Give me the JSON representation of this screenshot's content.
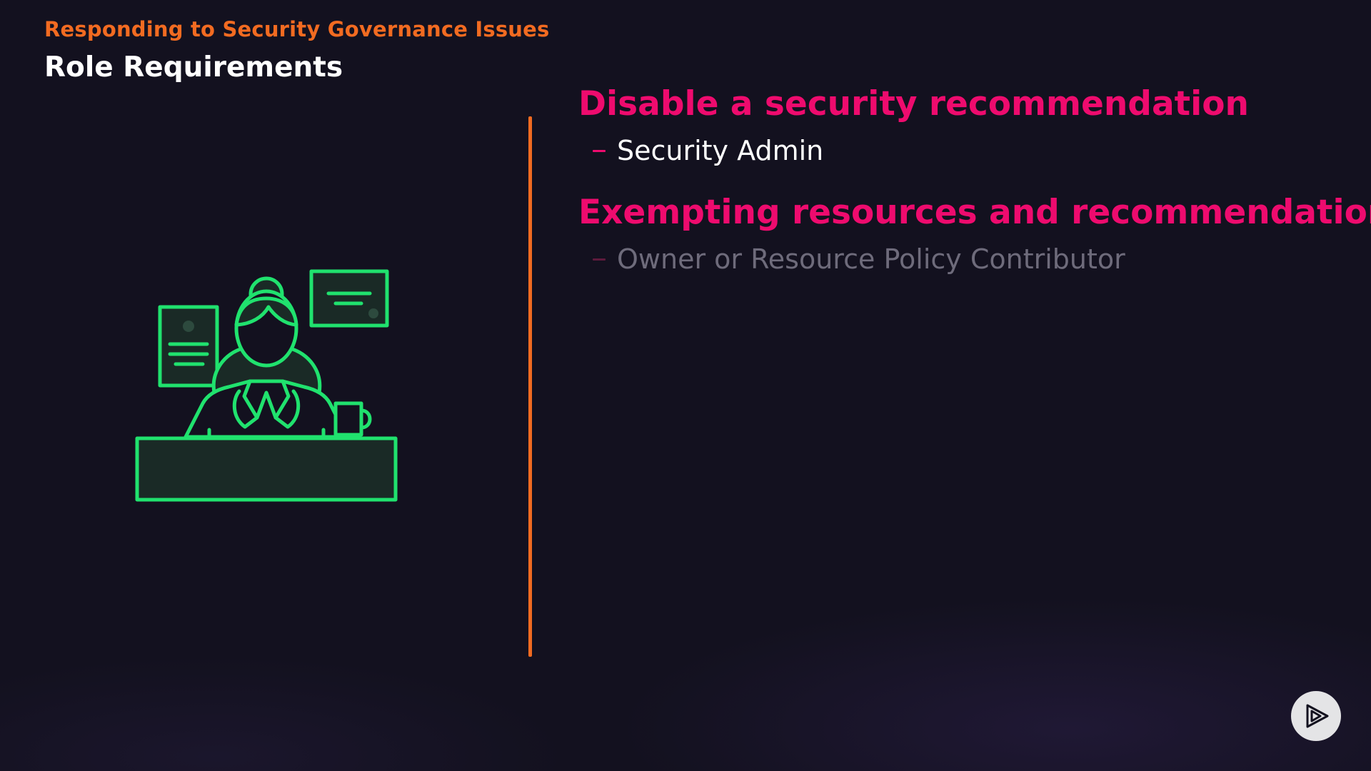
{
  "header": {
    "course_title": "Responding to Security Governance Issues",
    "slide_title": "Role Requirements"
  },
  "illustration": {
    "icon": "office-worker-at-desk-icon",
    "accent_color": "#20e26e"
  },
  "items": [
    {
      "heading": "Disable a security recommendation",
      "role": "Security Admin",
      "state": "active"
    },
    {
      "heading": "Exempting resources and recommendations",
      "role": "Owner or Resource Policy Contributor",
      "state": "dim"
    }
  ],
  "colors": {
    "background": "#13111f",
    "course_title": "#f26b21",
    "divider": "#f26b21",
    "heading": "#ee0b6e",
    "text_active": "#ffffff",
    "text_dim": "#6e6b7b"
  },
  "brand": {
    "logo_icon": "play-logo-icon"
  }
}
